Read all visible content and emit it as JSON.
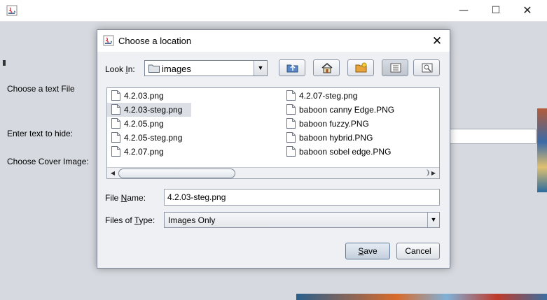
{
  "app": {
    "labels": {
      "choose_text_file": "Choose a text File",
      "enter_text": "Enter text to hide:",
      "choose_cover": "Choose Cover Image:"
    },
    "window_controls": {
      "minimize": "—",
      "maximize": "☐",
      "close": "✕"
    }
  },
  "dialog": {
    "title": "Choose a location",
    "close_glyph": "✕",
    "look_in": {
      "label_prefix": "Look ",
      "label_mnemonic": "I",
      "label_suffix": "n:",
      "value": "images"
    },
    "toolbar": [
      {
        "name": "up-one-level-icon"
      },
      {
        "name": "home-icon"
      },
      {
        "name": "new-folder-icon"
      },
      {
        "name": "list-view-icon",
        "active": true
      },
      {
        "name": "details-view-icon"
      }
    ],
    "files_col1": [
      {
        "name": "4.2.03.png"
      },
      {
        "name": "4.2.03-steg.png",
        "selected": true
      },
      {
        "name": "4.2.05.png"
      },
      {
        "name": "4.2.05-steg.png"
      },
      {
        "name": "4.2.07.png"
      }
    ],
    "files_col2": [
      {
        "name": "4.2.07-steg.png"
      },
      {
        "name": "baboon canny Edge.PNG"
      },
      {
        "name": "baboon fuzzy.PNG"
      },
      {
        "name": "baboon hybrid.PNG"
      },
      {
        "name": "baboon sobel edge.PNG"
      }
    ],
    "file_name": {
      "label_prefix": "File ",
      "label_mnemonic": "N",
      "label_suffix": "ame:",
      "value": "4.2.03-steg.png"
    },
    "files_of_type": {
      "label_prefix": "Files of ",
      "label_mnemonic": "T",
      "label_suffix": "ype:",
      "value": "Images Only"
    },
    "buttons": {
      "save_mnemonic": "S",
      "save_rest": "ave",
      "cancel": "Cancel"
    }
  },
  "colors": {
    "accent": "#5f7b9c",
    "selection": "#dce0e6",
    "dialog_bg": "#eef0f4"
  }
}
